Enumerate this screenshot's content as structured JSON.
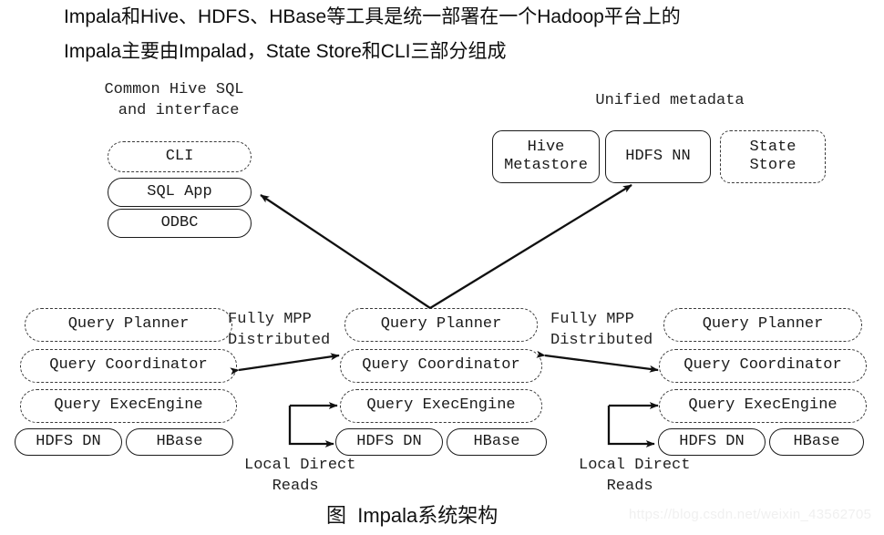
{
  "header": {
    "line1": "Impala和Hive、HDFS、HBase等工具是统一部署在一个Hadoop平台上的",
    "line2": "Impala主要由Impalad，State Store和CLI三部分组成"
  },
  "labels": {
    "common_hive_sql": "Common Hive SQL\n and interface",
    "unified_metadata": "Unified metadata",
    "fully_mpp_left": "Fully MPP\nDistributed",
    "fully_mpp_right": "Fully MPP\nDistributed",
    "local_direct_reads_center": "Local Direct\n   Reads",
    "local_direct_reads_right": "Local Direct\n   Reads"
  },
  "client_stack": {
    "cli": "CLI",
    "sql_app": "SQL App",
    "odbc": "ODBC"
  },
  "metadata_stack": {
    "hive_metastore": "Hive\nMetastore",
    "hdfs_nn": "HDFS NN",
    "state_store": "State\nStore"
  },
  "node_left": {
    "query_planner": "Query Planner",
    "query_coordinator": "Query Coordinator",
    "query_execengine": "Query ExecEngine",
    "hdfs_dn": "HDFS DN",
    "hbase": "HBase"
  },
  "node_center": {
    "query_planner": "Query Planner",
    "query_coordinator": "Query Coordinator",
    "query_execengine": "Query ExecEngine",
    "hdfs_dn": "HDFS DN",
    "hbase": "HBase"
  },
  "node_right": {
    "query_planner": "Query Planner",
    "query_coordinator": "Query Coordinator",
    "query_execengine": "Query ExecEngine",
    "hdfs_dn": "HDFS DN",
    "hbase": "HBase"
  },
  "caption": "图  Impala系统架构",
  "watermark": "https://blog.csdn.net/weixin_43562705",
  "colors": {
    "stroke": "#1a1a1a",
    "dashed_stroke": "#3a3a3a",
    "text": "#111111",
    "background": "#ffffff",
    "watermark": "#f0f0f0"
  }
}
